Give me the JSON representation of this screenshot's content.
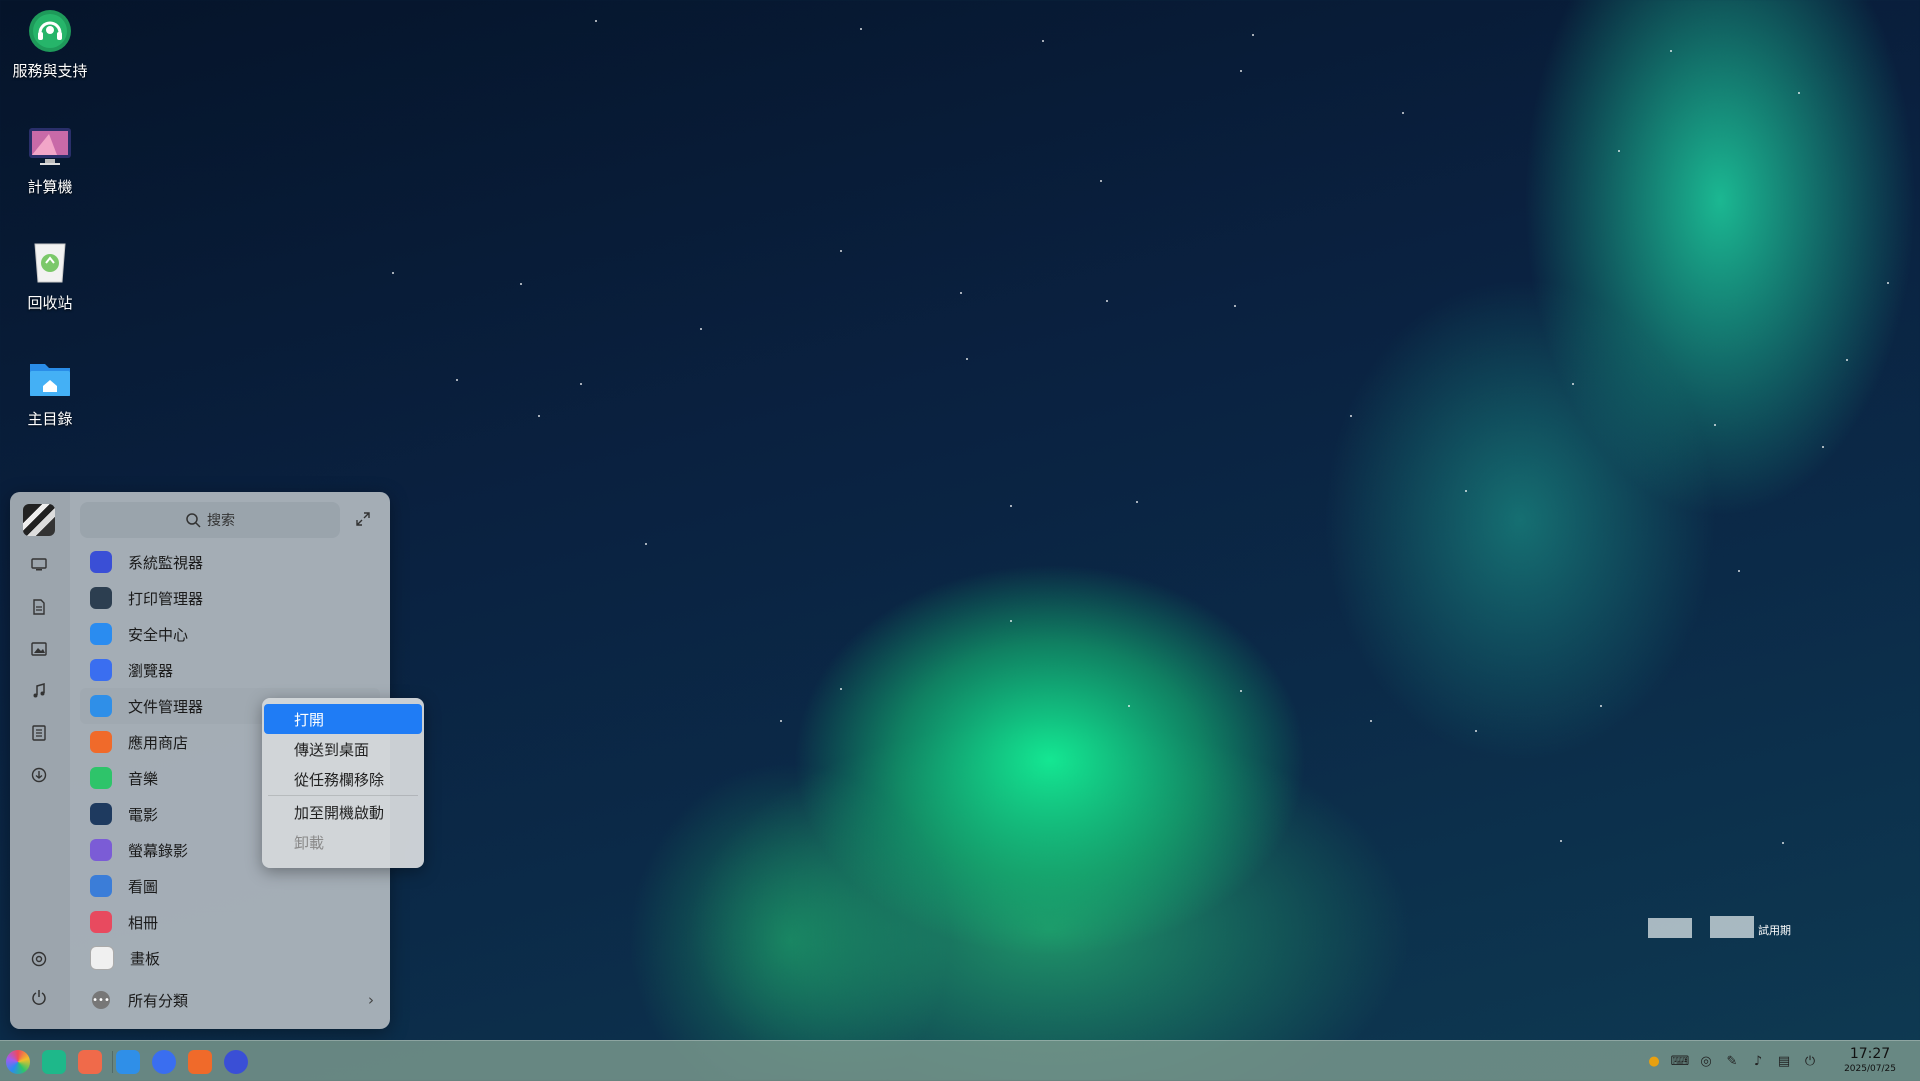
{
  "desktop": {
    "icons": [
      {
        "label": "服務與支持",
        "icon": "headset-support-icon"
      },
      {
        "label": "計算機",
        "icon": "computer-monitor-icon"
      },
      {
        "label": "回收站",
        "icon": "recycle-bin-icon"
      },
      {
        "label": "主目錄",
        "icon": "home-folder-icon"
      }
    ],
    "watermark": {
      "text": "試用期"
    }
  },
  "launcher": {
    "search_placeholder": "搜索",
    "apps": [
      {
        "label": "系統監視器",
        "icon": "system-monitor-icon",
        "color": "#3a4fd6"
      },
      {
        "label": "打印管理器",
        "icon": "printer-icon",
        "color": "#2c3e50"
      },
      {
        "label": "安全中心",
        "icon": "shield-icon",
        "color": "#2a8cf0"
      },
      {
        "label": "瀏覽器",
        "icon": "browser-icon",
        "color": "#3a6ef0"
      },
      {
        "label": "文件管理器",
        "icon": "file-manager-icon",
        "color": "#2f8fe8"
      },
      {
        "label": "應用商店",
        "icon": "app-store-icon",
        "color": "#f06a2a"
      },
      {
        "label": "音樂",
        "icon": "music-icon",
        "color": "#2ec46a"
      },
      {
        "label": "電影",
        "icon": "movie-icon",
        "color": "#1e3a5f"
      },
      {
        "label": "螢幕錄影",
        "icon": "screen-recorder-icon",
        "color": "#7b5cd6"
      },
      {
        "label": "看圖",
        "icon": "image-viewer-icon",
        "color": "#3b7dd8"
      },
      {
        "label": "相冊",
        "icon": "album-icon",
        "color": "#e84a5f"
      },
      {
        "label": "畫板",
        "icon": "draw-icon",
        "color": "#f0f0f0"
      }
    ],
    "all_categories": "所有分類"
  },
  "context_menu": {
    "items": [
      {
        "label": "打開",
        "state": "active"
      },
      {
        "label": "傳送到桌面",
        "state": "normal"
      },
      {
        "label": "從任務欄移除",
        "state": "normal"
      },
      {
        "label": "加至開機啟動",
        "state": "normal"
      },
      {
        "label": "卸載",
        "state": "disabled"
      }
    ]
  },
  "taskbar": {
    "clock_time": "17:27",
    "clock_date": "2025/07/25"
  }
}
